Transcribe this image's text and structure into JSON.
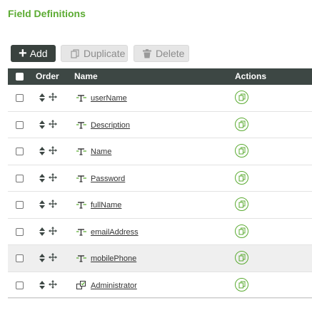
{
  "page": {
    "title": "Field Definitions"
  },
  "toolbar": {
    "add_label": "Add",
    "duplicate_label": "Duplicate",
    "delete_label": "Delete"
  },
  "table": {
    "headers": {
      "order": "Order",
      "name": "Name",
      "actions": "Actions"
    },
    "rows": [
      {
        "name": "userName",
        "type_icon": "text-field-icon"
      },
      {
        "name": "Description",
        "type_icon": "text-field-icon"
      },
      {
        "name": "Name",
        "type_icon": "text-field-icon"
      },
      {
        "name": "Password",
        "type_icon": "text-field-icon"
      },
      {
        "name": "fullName",
        "type_icon": "text-field-icon"
      },
      {
        "name": "emailAddress",
        "type_icon": "text-field-icon"
      },
      {
        "name": "mobilePhone",
        "type_icon": "text-field-icon",
        "highlighted": true
      },
      {
        "name": "Administrator",
        "type_icon": "checkbox-field-icon"
      }
    ]
  },
  "colors": {
    "accent": "#5bab32",
    "header_bg": "#3d4744",
    "button_dark": "#39423e"
  }
}
